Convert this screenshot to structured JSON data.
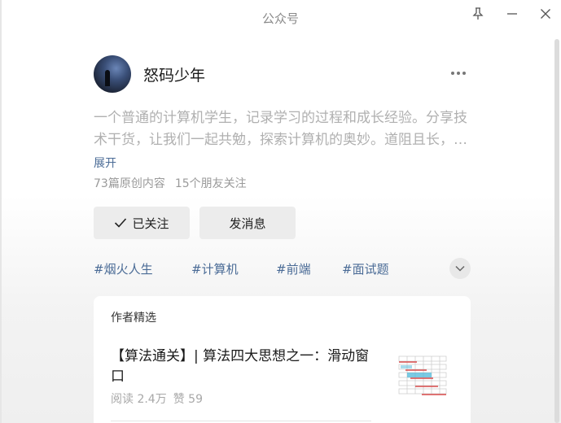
{
  "window": {
    "title": "公众号",
    "icons": {
      "pin": "pin-icon",
      "minimize": "minimize-icon",
      "close": "close-icon"
    }
  },
  "profile": {
    "name": "怒码少年",
    "description": "一个普通的计算机学生，记录学习的过程和成长经验。分享技术干货，让我们一起共勉，探索计算机的奥妙。道阻且长，行则将至",
    "expand_label": "展开",
    "original_count": "73篇原创内容",
    "friends_following": "15个朋友关注"
  },
  "actions": {
    "follow_label": "已关注",
    "message_label": "发消息"
  },
  "tags": [
    "#烟火人生",
    "#计算机",
    "#前端",
    "#面试题"
  ],
  "featured": {
    "section_title": "作者精选",
    "articles": [
      {
        "title": "【算法通关】| 算法四大思想之一：滑动窗口",
        "reads": "阅读 2.4万",
        "likes": "赞 59"
      }
    ]
  },
  "colors": {
    "link": "#4a6b96",
    "button_bg": "#ececec",
    "muted_text": "#9a9a9a"
  }
}
